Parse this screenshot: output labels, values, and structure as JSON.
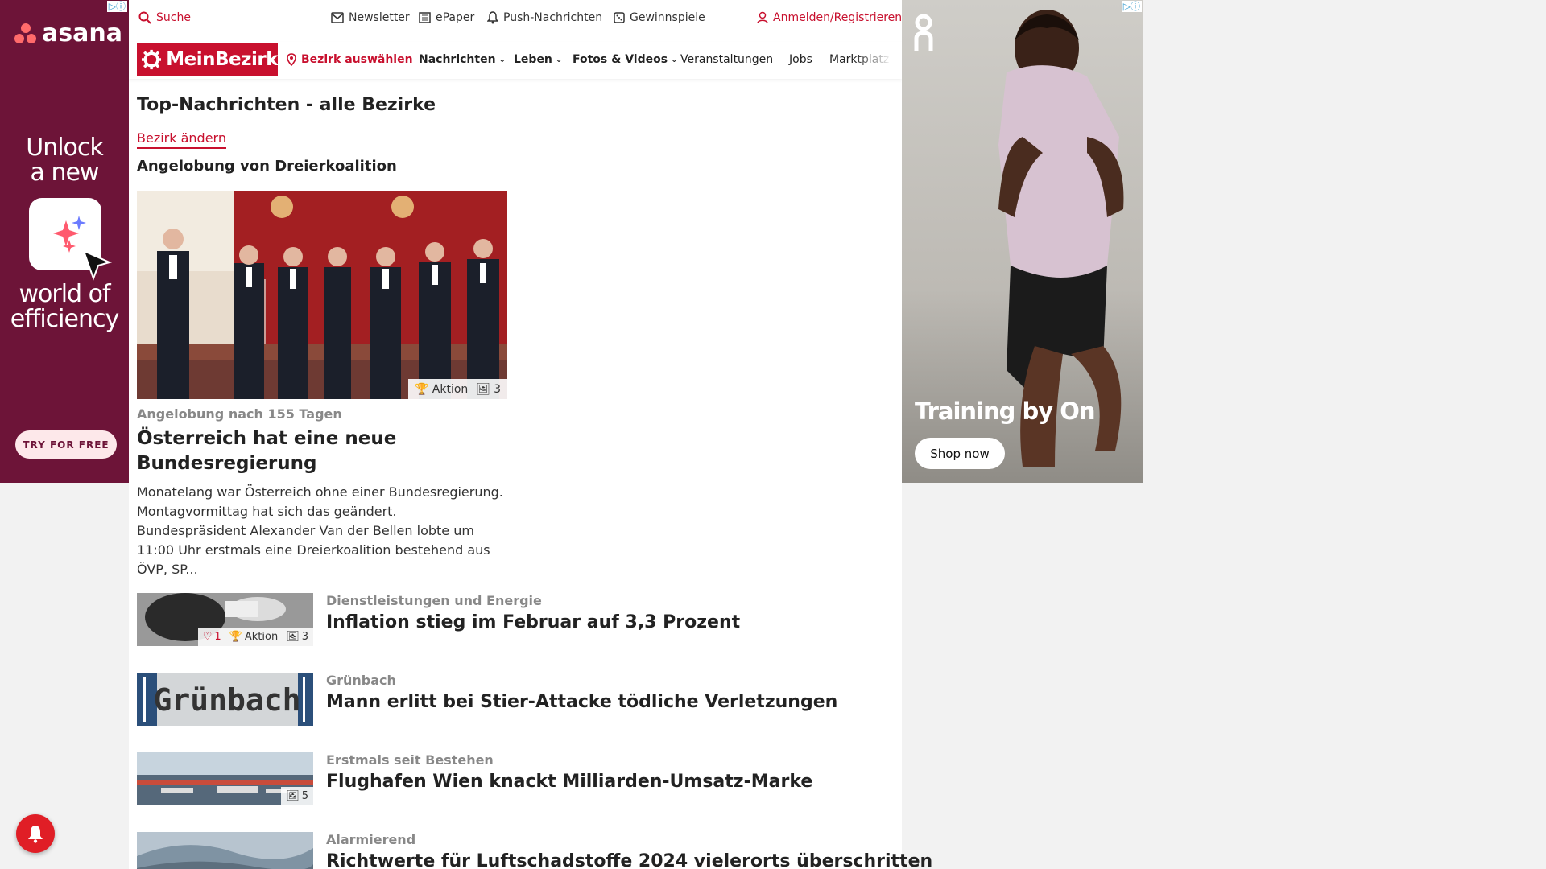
{
  "ads": {
    "left": {
      "brand": "asana",
      "headline1_line1": "Unlock",
      "headline1_line2": "a new",
      "headline2_line1": "world of",
      "headline2_line2": "efficiency",
      "cta": "TRY FOR FREE",
      "background": "#6d1438"
    },
    "right": {
      "title": "Training by On",
      "cta": "Shop now"
    }
  },
  "topbar": {
    "search": "Suche",
    "newsletter": "Newsletter",
    "epaper": "ePaper",
    "push": "Push-Nachrichten",
    "gewinnspiele": "Gewinnspiele",
    "login": "Anmelden/Registrieren"
  },
  "nav": {
    "logo": "MeinBezirk",
    "bezirk": "Bezirk auswählen",
    "items": [
      "Nachrichten",
      "Leben",
      "Fotos & Videos",
      "Veranstaltungen",
      "Jobs",
      "Marktplatz"
    ]
  },
  "page": {
    "title": "Top-Nachrichten - alle Bezirke",
    "change_link": "Bezirk ändern",
    "section_title": "Angelobung von Dreierkoalition"
  },
  "hero": {
    "badge_action": "Aktion",
    "badge_photos": "3",
    "kicker": "Angelobung nach 155 Tagen",
    "title": "Österreich hat eine neue Bundesregierung",
    "text": "Monatelang war Österreich ohne einer Bundesregierung. Montagvormittag hat sich das geändert. Bundespräsident Alexander Van der Bellen lobte um 11:00 Uhr erstmals eine Dreierkoalition bestehend aus ÖVP, SP..."
  },
  "teasers": [
    {
      "kicker": "Dienstleistungen und Energie",
      "title": "Inflation stieg im Februar auf 3,3 Prozent",
      "likes": "1",
      "action": "Aktion",
      "photos": "3"
    },
    {
      "kicker": "Grünbach",
      "title": "Mann erlitt bei Stier-Attacke tödliche Verletzungen",
      "sign_text": "Grünbach"
    },
    {
      "kicker": "Erstmals seit Bestehen",
      "title": "Flughafen Wien knackt Milliarden-Umsatz-Marke",
      "photos": "5"
    },
    {
      "kicker": "Alarmierend",
      "title": "Richtwerte für Luftschadstoffe 2024 vielerorts überschritten"
    }
  ],
  "colors": {
    "brand_red": "#c8102e",
    "text": "#222222",
    "kicker": "#888888"
  }
}
